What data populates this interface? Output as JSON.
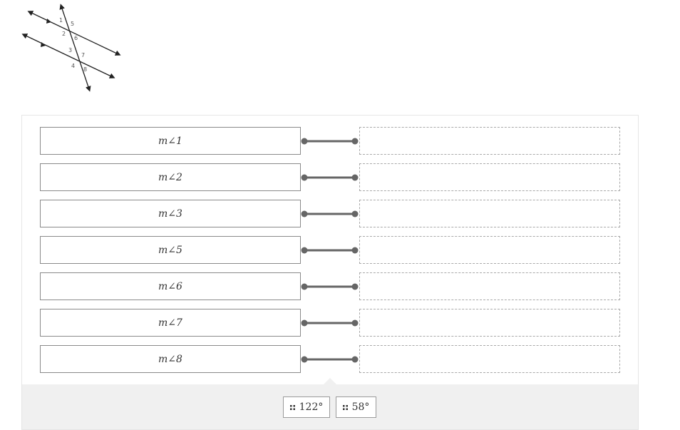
{
  "figure": {
    "angle_labels": [
      "1",
      "2",
      "3",
      "4",
      "5",
      "6",
      "7",
      "8"
    ]
  },
  "rows": [
    {
      "prompt": "m∠1"
    },
    {
      "prompt": "m∠2"
    },
    {
      "prompt": "m∠3"
    },
    {
      "prompt": "m∠5"
    },
    {
      "prompt": "m∠6"
    },
    {
      "prompt": "m∠7"
    },
    {
      "prompt": "m∠8"
    }
  ],
  "choices": [
    {
      "label": "122°",
      "icon": "drag-handle-icon"
    },
    {
      "label": "58°",
      "icon": "drag-handle-icon"
    }
  ],
  "colors": {
    "connector": "#666666",
    "prompt_border": "#8a8a8a",
    "target_border": "#a9a9a9",
    "tray_background": "#f0f0f0"
  }
}
